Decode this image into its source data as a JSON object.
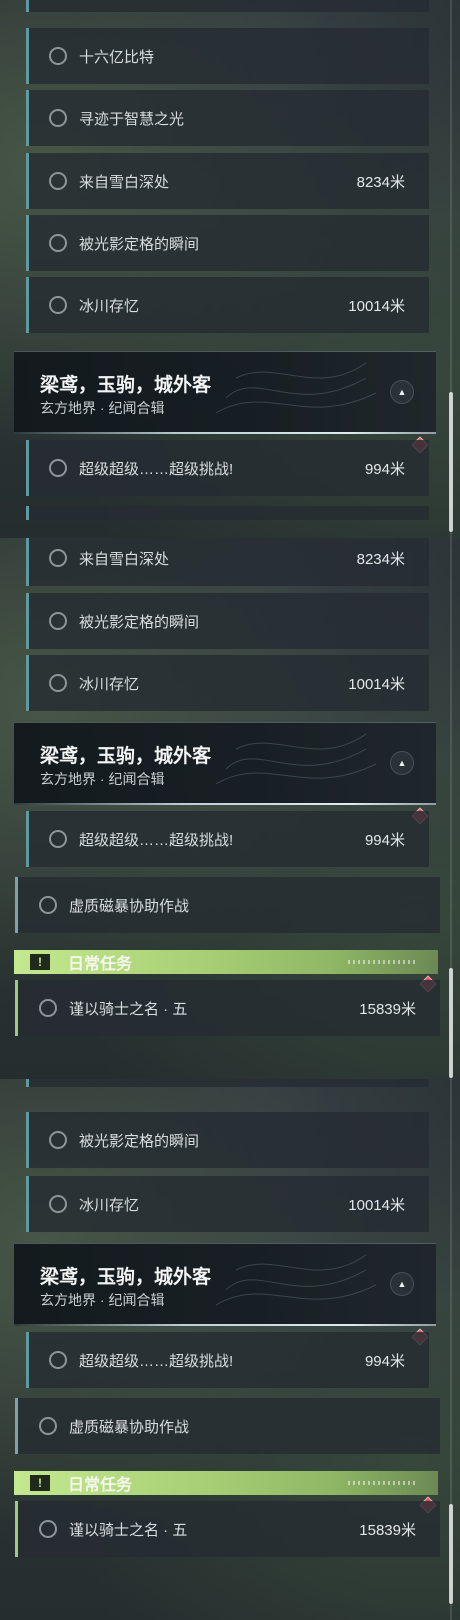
{
  "colors": {
    "accent_teal": "#5f9aa1",
    "daily_green": "#a8cf75",
    "marker_red": "#d8505e"
  },
  "icons": {
    "quest_state": "circle-outline-icon",
    "collapse": "chevron-up-icon",
    "marker": "red-diamond-marker-icon",
    "daily": "exclamation-box-icon"
  },
  "panel1": {
    "items": [
      {
        "name": "十六亿比特",
        "distance": ""
      },
      {
        "name": "寻迹于智慧之光",
        "distance": ""
      },
      {
        "name": "来自雪白深处",
        "distance": "8234米"
      },
      {
        "name": "被光影定格的瞬间",
        "distance": ""
      },
      {
        "name": "冰川存忆",
        "distance": "10014米"
      }
    ],
    "group": {
      "title": "梁鸢，玉驹，城外客",
      "subtitle": "玄方地界 · 纪闻合辑"
    },
    "after": {
      "name": "超级超级……超级挑战!",
      "distance": "994米"
    }
  },
  "panel2": {
    "items": [
      {
        "name": "来自雪白深处",
        "distance": "8234米"
      },
      {
        "name": "被光影定格的瞬间",
        "distance": ""
      },
      {
        "name": "冰川存忆",
        "distance": "10014米"
      }
    ],
    "group": {
      "title": "梁鸢，玉驹，城外客",
      "subtitle": "玄方地界 · 纪闻合辑"
    },
    "after": {
      "name": "超级超级……超级挑战!",
      "distance": "994米"
    },
    "standalone": {
      "name": "虚质磁暴协助作战"
    },
    "daily": {
      "title": "日常任务",
      "icon_glyph": "!",
      "item": {
        "name": "谨以骑士之名 · 五",
        "distance": "15839米"
      }
    }
  },
  "panel3": {
    "items": [
      {
        "name": "被光影定格的瞬间",
        "distance": ""
      },
      {
        "name": "冰川存忆",
        "distance": "10014米"
      }
    ],
    "group": {
      "title": "梁鸢，玉驹，城外客",
      "subtitle": "玄方地界 · 纪闻合辑"
    },
    "after": {
      "name": "超级超级……超级挑战!",
      "distance": "994米"
    },
    "standalone": {
      "name": "虚质磁暴协助作战"
    },
    "daily": {
      "title": "日常任务",
      "icon_glyph": "!",
      "item": {
        "name": "谨以骑士之名 · 五",
        "distance": "15839米"
      }
    }
  },
  "collapse_glyph": "▲"
}
